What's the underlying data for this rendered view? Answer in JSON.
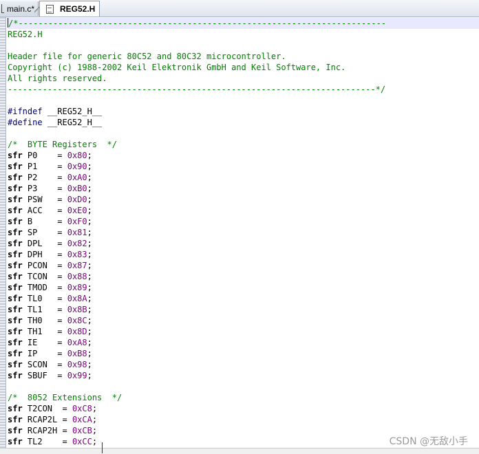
{
  "tabs": [
    {
      "label": "main.c*",
      "active": false
    },
    {
      "label": "REG52.H",
      "active": true
    }
  ],
  "editor": {
    "lines": [
      [
        {
          "t": "cm",
          "v": "/*--------------------------------------------------------------------------"
        }
      ],
      [
        {
          "t": "cm",
          "v": "REG52.H"
        }
      ],
      [
        {
          "t": "cm",
          "v": ""
        }
      ],
      [
        {
          "t": "cm",
          "v": "Header file for generic 80C52 and 80C32 microcontroller."
        }
      ],
      [
        {
          "t": "cm",
          "v": "Copyright (c) 1988-2002 Keil Elektronik GmbH and Keil Software, Inc."
        }
      ],
      [
        {
          "t": "cm",
          "v": "All rights reserved."
        }
      ],
      [
        {
          "t": "cm",
          "v": "--------------------------------------------------------------------------*/"
        }
      ],
      [],
      [
        {
          "t": "pp",
          "v": "#ifndef"
        },
        {
          "t": "id",
          "v": " __REG52_H__"
        }
      ],
      [
        {
          "t": "pp",
          "v": "#define"
        },
        {
          "t": "id",
          "v": " __REG52_H__"
        }
      ],
      [],
      [
        {
          "t": "cm",
          "v": "/*  BYTE Registers  */"
        }
      ],
      [
        {
          "t": "kw",
          "v": "sfr"
        },
        {
          "t": "id",
          "v": " P0    = "
        },
        {
          "t": "num",
          "v": "0x80"
        },
        {
          "t": "id",
          "v": ";"
        }
      ],
      [
        {
          "t": "kw",
          "v": "sfr"
        },
        {
          "t": "id",
          "v": " P1    = "
        },
        {
          "t": "num",
          "v": "0x90"
        },
        {
          "t": "id",
          "v": ";"
        }
      ],
      [
        {
          "t": "kw",
          "v": "sfr"
        },
        {
          "t": "id",
          "v": " P2    = "
        },
        {
          "t": "num",
          "v": "0xA0"
        },
        {
          "t": "id",
          "v": ";"
        }
      ],
      [
        {
          "t": "kw",
          "v": "sfr"
        },
        {
          "t": "id",
          "v": " P3    = "
        },
        {
          "t": "num",
          "v": "0xB0"
        },
        {
          "t": "id",
          "v": ";"
        }
      ],
      [
        {
          "t": "kw",
          "v": "sfr"
        },
        {
          "t": "id",
          "v": " PSW   = "
        },
        {
          "t": "num",
          "v": "0xD0"
        },
        {
          "t": "id",
          "v": ";"
        }
      ],
      [
        {
          "t": "kw",
          "v": "sfr"
        },
        {
          "t": "id",
          "v": " ACC   = "
        },
        {
          "t": "num",
          "v": "0xE0"
        },
        {
          "t": "id",
          "v": ";"
        }
      ],
      [
        {
          "t": "kw",
          "v": "sfr"
        },
        {
          "t": "id",
          "v": " B     = "
        },
        {
          "t": "num",
          "v": "0xF0"
        },
        {
          "t": "id",
          "v": ";"
        }
      ],
      [
        {
          "t": "kw",
          "v": "sfr"
        },
        {
          "t": "id",
          "v": " SP    = "
        },
        {
          "t": "num",
          "v": "0x81"
        },
        {
          "t": "id",
          "v": ";"
        }
      ],
      [
        {
          "t": "kw",
          "v": "sfr"
        },
        {
          "t": "id",
          "v": " DPL   = "
        },
        {
          "t": "num",
          "v": "0x82"
        },
        {
          "t": "id",
          "v": ";"
        }
      ],
      [
        {
          "t": "kw",
          "v": "sfr"
        },
        {
          "t": "id",
          "v": " DPH   = "
        },
        {
          "t": "num",
          "v": "0x83"
        },
        {
          "t": "id",
          "v": ";"
        }
      ],
      [
        {
          "t": "kw",
          "v": "sfr"
        },
        {
          "t": "id",
          "v": " PCON  = "
        },
        {
          "t": "num",
          "v": "0x87"
        },
        {
          "t": "id",
          "v": ";"
        }
      ],
      [
        {
          "t": "kw",
          "v": "sfr"
        },
        {
          "t": "id",
          "v": " TCON  = "
        },
        {
          "t": "num",
          "v": "0x88"
        },
        {
          "t": "id",
          "v": ";"
        }
      ],
      [
        {
          "t": "kw",
          "v": "sfr"
        },
        {
          "t": "id",
          "v": " TMOD  = "
        },
        {
          "t": "num",
          "v": "0x89"
        },
        {
          "t": "id",
          "v": ";"
        }
      ],
      [
        {
          "t": "kw",
          "v": "sfr"
        },
        {
          "t": "id",
          "v": " TL0   = "
        },
        {
          "t": "num",
          "v": "0x8A"
        },
        {
          "t": "id",
          "v": ";"
        }
      ],
      [
        {
          "t": "kw",
          "v": "sfr"
        },
        {
          "t": "id",
          "v": " TL1   = "
        },
        {
          "t": "num",
          "v": "0x8B"
        },
        {
          "t": "id",
          "v": ";"
        }
      ],
      [
        {
          "t": "kw",
          "v": "sfr"
        },
        {
          "t": "id",
          "v": " TH0   = "
        },
        {
          "t": "num",
          "v": "0x8C"
        },
        {
          "t": "id",
          "v": ";"
        }
      ],
      [
        {
          "t": "kw",
          "v": "sfr"
        },
        {
          "t": "id",
          "v": " TH1   = "
        },
        {
          "t": "num",
          "v": "0x8D"
        },
        {
          "t": "id",
          "v": ";"
        }
      ],
      [
        {
          "t": "kw",
          "v": "sfr"
        },
        {
          "t": "id",
          "v": " IE    = "
        },
        {
          "t": "num",
          "v": "0xA8"
        },
        {
          "t": "id",
          "v": ";"
        }
      ],
      [
        {
          "t": "kw",
          "v": "sfr"
        },
        {
          "t": "id",
          "v": " IP    = "
        },
        {
          "t": "num",
          "v": "0xB8"
        },
        {
          "t": "id",
          "v": ";"
        }
      ],
      [
        {
          "t": "kw",
          "v": "sfr"
        },
        {
          "t": "id",
          "v": " SCON  = "
        },
        {
          "t": "num",
          "v": "0x98"
        },
        {
          "t": "id",
          "v": ";"
        }
      ],
      [
        {
          "t": "kw",
          "v": "sfr"
        },
        {
          "t": "id",
          "v": " SBUF  = "
        },
        {
          "t": "num",
          "v": "0x99"
        },
        {
          "t": "id",
          "v": ";"
        }
      ],
      [],
      [
        {
          "t": "cm",
          "v": "/*  8052 Extensions  */"
        }
      ],
      [
        {
          "t": "kw",
          "v": "sfr"
        },
        {
          "t": "id",
          "v": " T2CON  = "
        },
        {
          "t": "num",
          "v": "0xC8"
        },
        {
          "t": "id",
          "v": ";"
        }
      ],
      [
        {
          "t": "kw",
          "v": "sfr"
        },
        {
          "t": "id",
          "v": " RCAP2L = "
        },
        {
          "t": "num",
          "v": "0xCA"
        },
        {
          "t": "id",
          "v": ";"
        }
      ],
      [
        {
          "t": "kw",
          "v": "sfr"
        },
        {
          "t": "id",
          "v": " RCAP2H = "
        },
        {
          "t": "num",
          "v": "0xCB"
        },
        {
          "t": "id",
          "v": ";"
        }
      ],
      [
        {
          "t": "kw",
          "v": "sfr"
        },
        {
          "t": "id",
          "v": " TL2    = "
        },
        {
          "t": "num",
          "v": "0xCC"
        },
        {
          "t": "id",
          "v": ";"
        }
      ]
    ]
  },
  "watermark": "CSDN @无敌小手",
  "colors": {
    "comment": "#008000",
    "preprocessor": "#000080",
    "keyword": "#000000",
    "number": "#800080",
    "current_line": "#e8e8ff"
  }
}
